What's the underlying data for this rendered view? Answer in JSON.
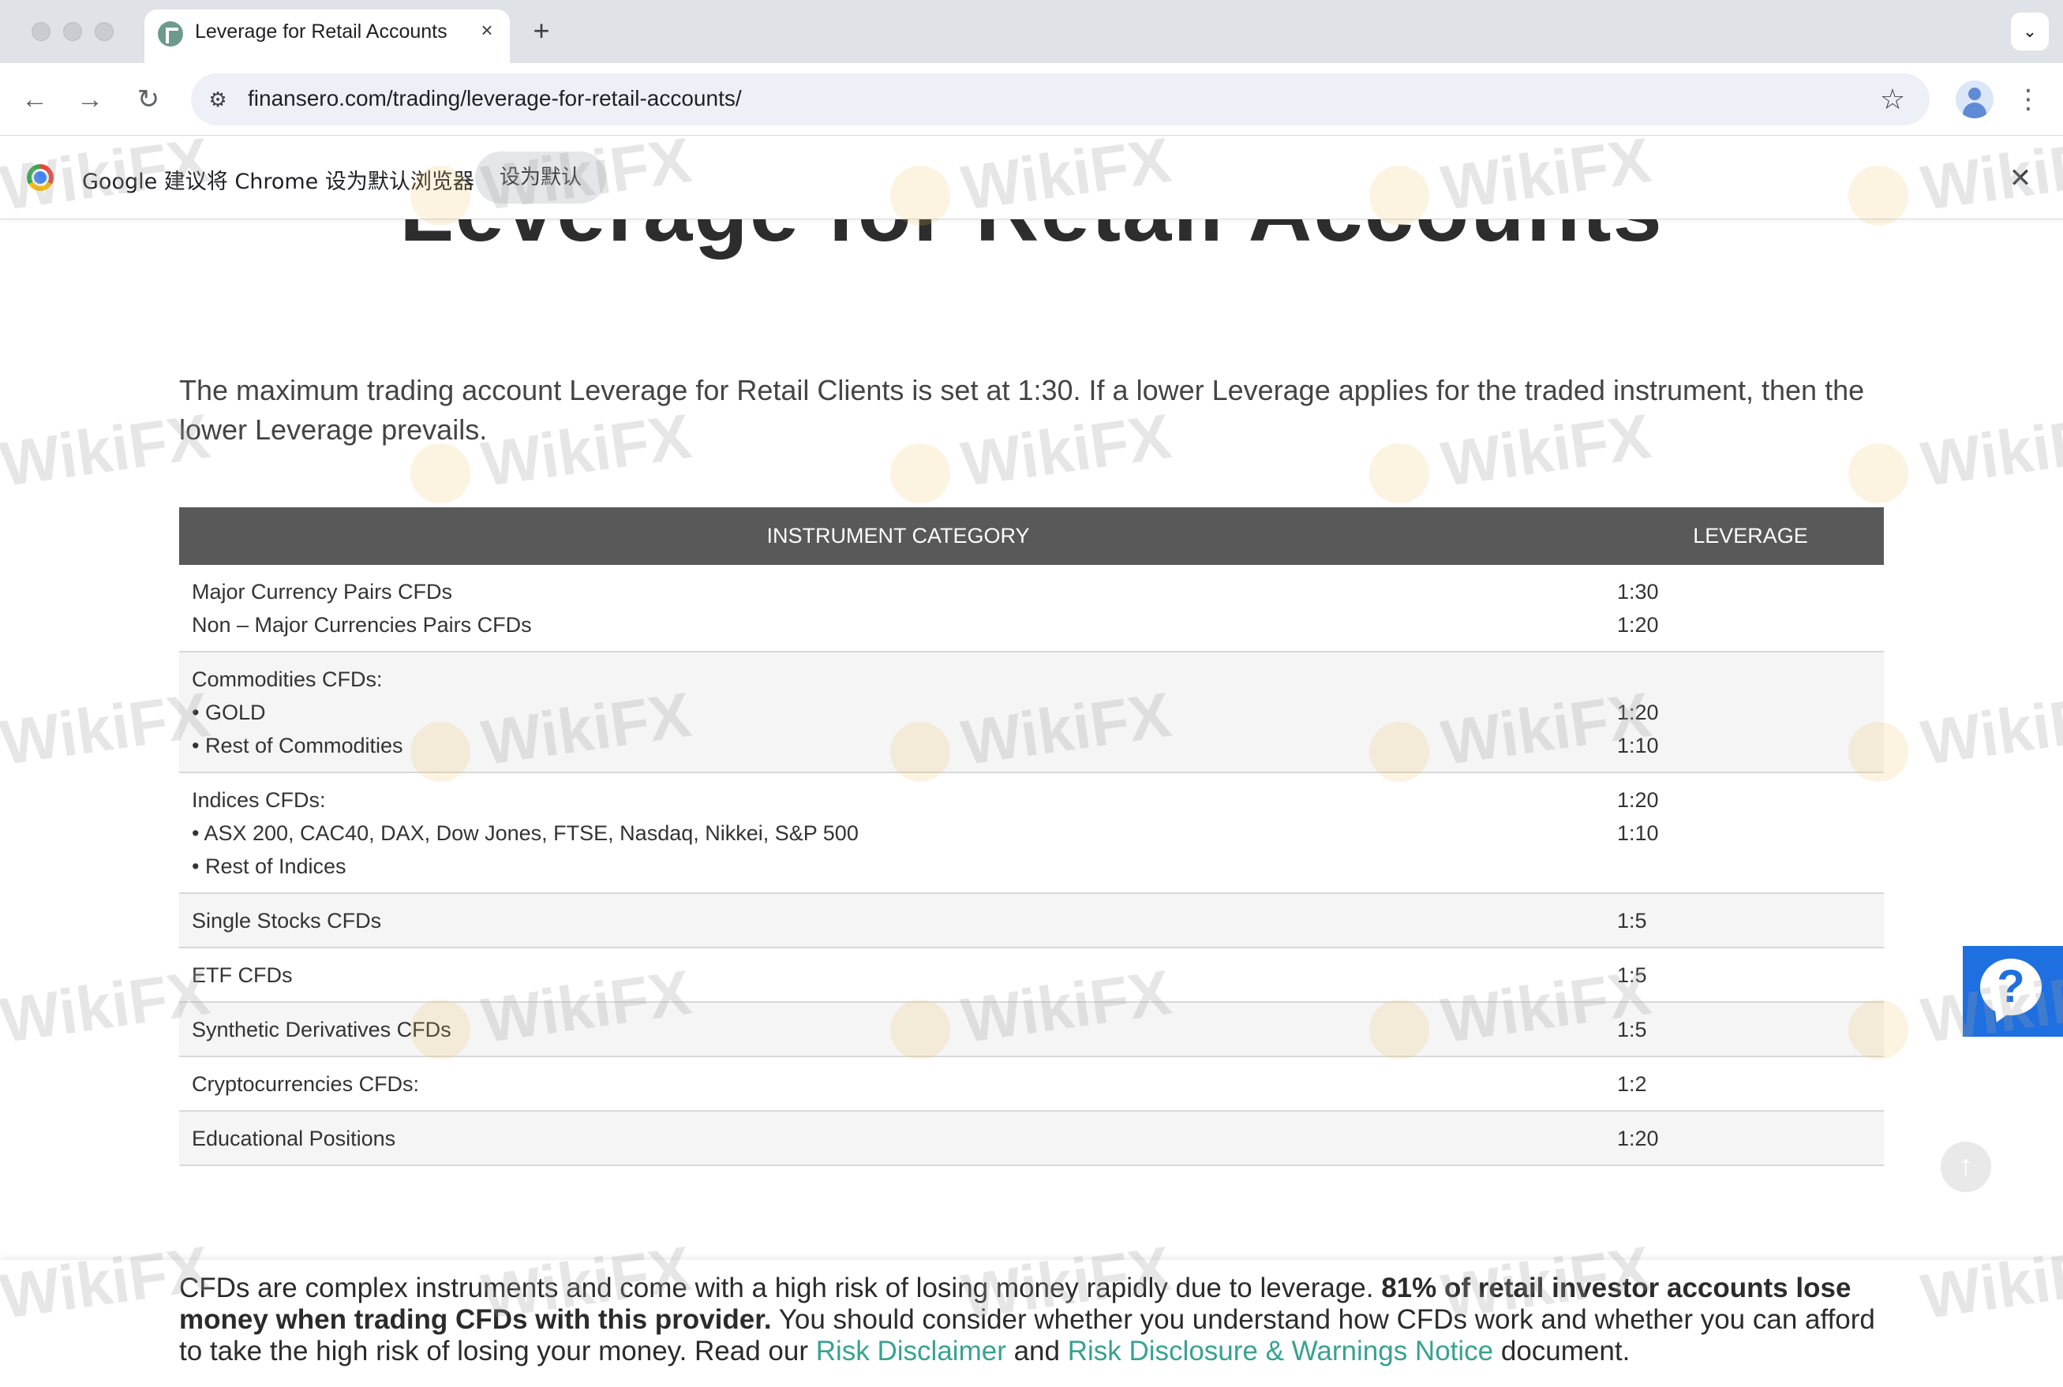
{
  "browser": {
    "tab_title": "Leverage for Retail Accounts",
    "tab_close": "×",
    "new_tab": "+",
    "tab_menu": "⌄",
    "url": "finansero.com/trading/leverage-for-retail-accounts/",
    "infobar_text": "Google 建议将 Chrome 设为默认浏览器",
    "infobar_button": "设为默认",
    "infobar_close": "✕"
  },
  "page": {
    "heading": "Leverage for Retail Accounts",
    "intro": "The maximum trading account Leverage for Retail Clients is set at 1:30. If a lower Leverage applies for the traded instrument, then the lower Leverage prevails."
  },
  "table": {
    "headers": {
      "category": "INSTRUMENT CATEGORY",
      "leverage": "LEVERAGE"
    },
    "rows": [
      {
        "category": [
          "Major Currency Pairs CFDs",
          "Non – Major Currencies Pairs CFDs"
        ],
        "leverage": [
          "1:30",
          "1:20"
        ]
      },
      {
        "category": [
          "Commodities CFDs:",
          "• GOLD",
          "• Rest of Commodities"
        ],
        "leverage": [
          "",
          "1:20",
          "1:10"
        ]
      },
      {
        "category": [
          "Indices CFDs:",
          "• ASX 200, CAC40, DAX, Dow Jones, FTSE, Nasdaq, Nikkei, S&P 500",
          "• Rest of Indices"
        ],
        "leverage": [
          "1:20",
          "1:10"
        ]
      },
      {
        "category": [
          "Single Stocks CFDs"
        ],
        "leverage": [
          "1:5"
        ]
      },
      {
        "category": [
          "ETF CFDs"
        ],
        "leverage": [
          "1:5"
        ]
      },
      {
        "category": [
          "Synthetic Derivatives CFDs"
        ],
        "leverage": [
          "1:5"
        ]
      },
      {
        "category": [
          "Cryptocurrencies CFDs:"
        ],
        "leverage": [
          "1:2"
        ]
      },
      {
        "category": [
          "Educational Positions"
        ],
        "leverage": [
          "1:20"
        ]
      }
    ]
  },
  "disclaimer": {
    "part1": "CFDs are complex instruments and come with a high risk of losing money rapidly due to leverage. ",
    "bold": "81% of retail investor accounts lose money when trading CFDs with this provider.",
    "part2": " You should consider whether you understand how CFDs work and whether you can afford to take the high risk of losing your money. Read our ",
    "link1": "Risk Disclaimer",
    "and": " and ",
    "link2": "Risk Disclosure & Warnings Notice",
    "part3": " document."
  },
  "widgets": {
    "help_symbol": "?",
    "scroll_top_symbol": "↑"
  },
  "watermark": "WikiFX",
  "colors": {
    "table_header": "#595959",
    "link": "#37a290",
    "help_widget": "#1e6fe0"
  }
}
